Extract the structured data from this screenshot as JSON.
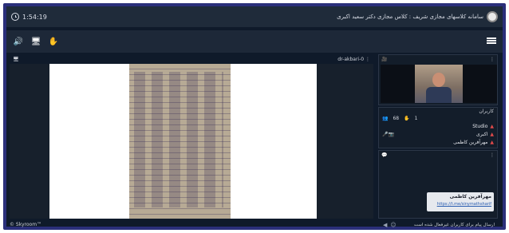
{
  "titlebar": {
    "timer": "1:54:19",
    "app_title": "سامانه کلاسهای مجازی شریف : کلاس مجازی دکتر سعید اکبری"
  },
  "toolbar": {
    "speaker_icon": "🔊",
    "present_icon": "🖥",
    "hand_icon": "✋",
    "menu": "menu-icon"
  },
  "content": {
    "presenter": "dr-akbari-0"
  },
  "video": {
    "panel_icon": "🎥"
  },
  "users": {
    "title": "کاربران",
    "stats": {
      "users_count": "68",
      "hand_count": "1"
    },
    "list": [
      {
        "name": "Studio"
      },
      {
        "name": "اکبری"
      },
      {
        "name": "مهرآفرین کاظمی"
      }
    ]
  },
  "chat": {
    "message": {
      "author": "مهرآفرین کاظمی",
      "link": "https://t.me/sinymathsharif"
    },
    "input_placeholder": "ارسال پیام برای کاربران غیرفعال شده است"
  },
  "footer": {
    "text": "© Skyroom™"
  }
}
